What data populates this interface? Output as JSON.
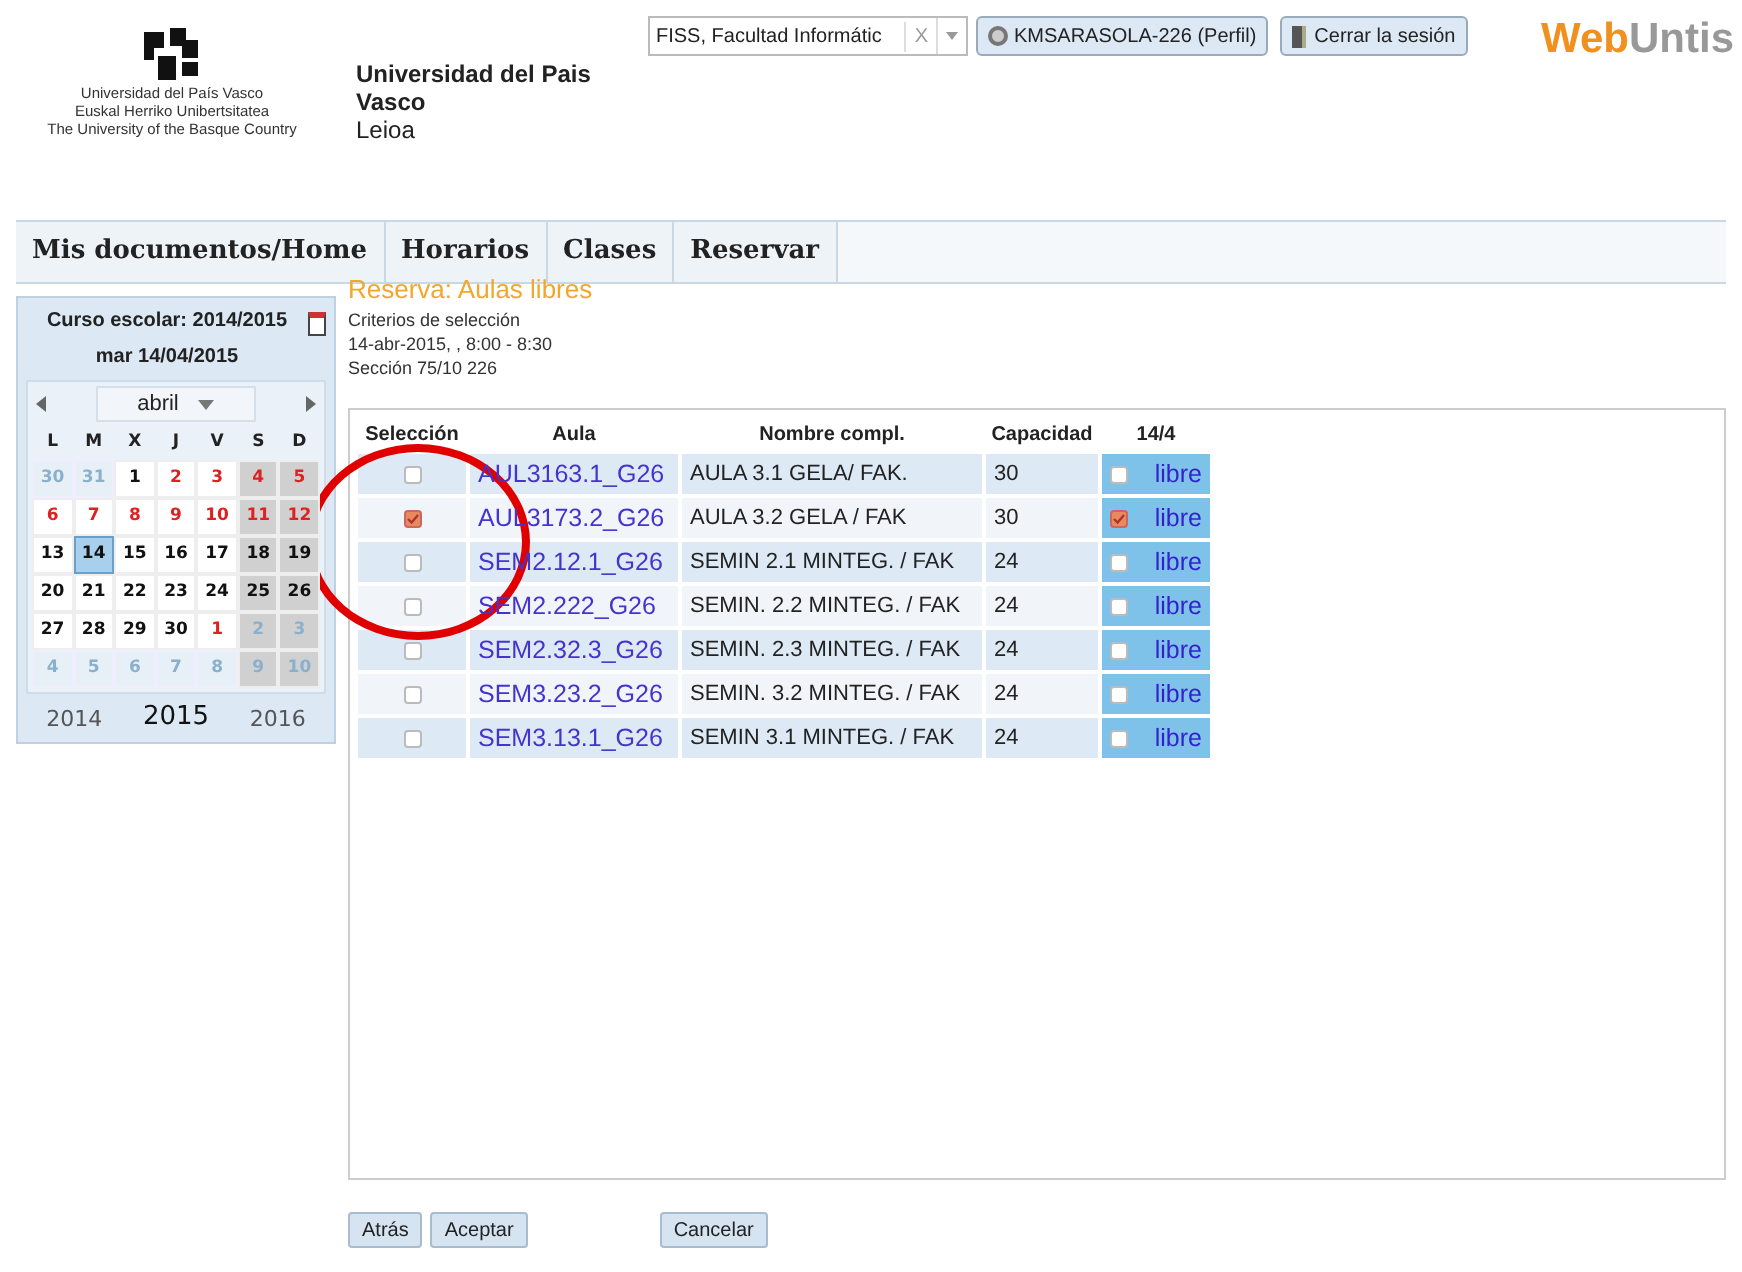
{
  "header": {
    "logo_lines": [
      "Universidad del País Vasco",
      "Euskal Herriko Unibertsitatea",
      "The University of the Basque Country"
    ],
    "university": "Universidad del Pais Vasco",
    "campus": "Leioa",
    "school_select": {
      "value": "FISS, Facultad Informátic",
      "clear": "X"
    },
    "profile_button": "KMSARASOLA-226 (Perfil)",
    "logout_button": "Cerrar la sesión",
    "brand": {
      "part1": "Web",
      "part2": "Untis"
    }
  },
  "nav": [
    {
      "label": "Mis documentos/Home",
      "selected": false
    },
    {
      "label": "Horarios",
      "selected": false
    },
    {
      "label": "Clases",
      "selected": false
    },
    {
      "label": "Reservar",
      "selected": false
    }
  ],
  "sidebar": {
    "school_year": "Curso escolar: 2014/2015",
    "date": "mar 14/04/2015",
    "month": "abril",
    "weekdays": [
      "L",
      "M",
      "X",
      "J",
      "V",
      "S",
      "D"
    ],
    "weeks": [
      [
        {
          "day": "30",
          "kind": "other",
          "weekend": false,
          "selected": false
        },
        {
          "day": "31",
          "kind": "other",
          "weekend": false,
          "selected": false
        },
        {
          "day": "1",
          "kind": "normal",
          "weekend": false,
          "selected": false
        },
        {
          "day": "2",
          "kind": "holiday",
          "weekend": false,
          "selected": false
        },
        {
          "day": "3",
          "kind": "holiday",
          "weekend": false,
          "selected": false
        },
        {
          "day": "4",
          "kind": "holiday",
          "weekend": true,
          "selected": false
        },
        {
          "day": "5",
          "kind": "holiday",
          "weekend": true,
          "selected": false
        }
      ],
      [
        {
          "day": "6",
          "kind": "holiday",
          "weekend": false,
          "selected": false
        },
        {
          "day": "7",
          "kind": "holiday",
          "weekend": false,
          "selected": false
        },
        {
          "day": "8",
          "kind": "holiday",
          "weekend": false,
          "selected": false
        },
        {
          "day": "9",
          "kind": "holiday",
          "weekend": false,
          "selected": false
        },
        {
          "day": "10",
          "kind": "holiday",
          "weekend": false,
          "selected": false
        },
        {
          "day": "11",
          "kind": "holiday",
          "weekend": true,
          "selected": false
        },
        {
          "day": "12",
          "kind": "holiday",
          "weekend": true,
          "selected": false
        }
      ],
      [
        {
          "day": "13",
          "kind": "normal",
          "weekend": false,
          "selected": false
        },
        {
          "day": "14",
          "kind": "normal",
          "weekend": false,
          "selected": true
        },
        {
          "day": "15",
          "kind": "normal",
          "weekend": false,
          "selected": false
        },
        {
          "day": "16",
          "kind": "normal",
          "weekend": false,
          "selected": false
        },
        {
          "day": "17",
          "kind": "normal",
          "weekend": false,
          "selected": false
        },
        {
          "day": "18",
          "kind": "normal",
          "weekend": true,
          "selected": false
        },
        {
          "day": "19",
          "kind": "normal",
          "weekend": true,
          "selected": false
        }
      ],
      [
        {
          "day": "20",
          "kind": "normal",
          "weekend": false,
          "selected": false
        },
        {
          "day": "21",
          "kind": "normal",
          "weekend": false,
          "selected": false
        },
        {
          "day": "22",
          "kind": "normal",
          "weekend": false,
          "selected": false
        },
        {
          "day": "23",
          "kind": "normal",
          "weekend": false,
          "selected": false
        },
        {
          "day": "24",
          "kind": "normal",
          "weekend": false,
          "selected": false
        },
        {
          "day": "25",
          "kind": "normal",
          "weekend": true,
          "selected": false
        },
        {
          "day": "26",
          "kind": "normal",
          "weekend": true,
          "selected": false
        }
      ],
      [
        {
          "day": "27",
          "kind": "normal",
          "weekend": false,
          "selected": false
        },
        {
          "day": "28",
          "kind": "normal",
          "weekend": false,
          "selected": false
        },
        {
          "day": "29",
          "kind": "normal",
          "weekend": false,
          "selected": false
        },
        {
          "day": "30",
          "kind": "normal",
          "weekend": false,
          "selected": false
        },
        {
          "day": "1",
          "kind": "holiday",
          "weekend": false,
          "selected": false
        },
        {
          "day": "2",
          "kind": "other",
          "weekend": true,
          "selected": false
        },
        {
          "day": "3",
          "kind": "other",
          "weekend": true,
          "selected": false
        }
      ],
      [
        {
          "day": "4",
          "kind": "other",
          "weekend": false,
          "selected": false
        },
        {
          "day": "5",
          "kind": "other",
          "weekend": false,
          "selected": false
        },
        {
          "day": "6",
          "kind": "other",
          "weekend": false,
          "selected": false
        },
        {
          "day": "7",
          "kind": "other",
          "weekend": false,
          "selected": false
        },
        {
          "day": "8",
          "kind": "other",
          "weekend": false,
          "selected": false
        },
        {
          "day": "9",
          "kind": "other",
          "weekend": true,
          "selected": false
        },
        {
          "day": "10",
          "kind": "other",
          "weekend": true,
          "selected": false
        }
      ]
    ],
    "years": [
      {
        "label": "2014",
        "selected": false
      },
      {
        "label": "2015",
        "selected": true
      },
      {
        "label": "2016",
        "selected": false
      }
    ]
  },
  "content": {
    "title": "Reserva: Aulas libres",
    "criteria": [
      "Criterios de selección",
      "14-abr-2015, , 8:00 - 8:30",
      "Sección 75/10 226"
    ],
    "table": {
      "columns": [
        "Selección",
        "Aula",
        "Nombre compl.",
        "Capacidad",
        "14/4"
      ],
      "rows": [
        {
          "checked": false,
          "aula": "AUL3163.1_G26",
          "name": "AULA 3.1 GELA/ FAK.",
          "capacity": "30",
          "slot_checked": false,
          "slot": "libre"
        },
        {
          "checked": true,
          "aula": "AUL3173.2_G26",
          "name": "AULA 3.2 GELA / FAK",
          "capacity": "30",
          "slot_checked": true,
          "slot": "libre"
        },
        {
          "checked": false,
          "aula": "SEM2.12.1_G26",
          "name": "SEMIN 2.1 MINTEG. / FAK",
          "capacity": "24",
          "slot_checked": false,
          "slot": "libre"
        },
        {
          "checked": false,
          "aula": "SEM2.222_G26",
          "name": "SEMIN. 2.2 MINTEG. / FAK",
          "capacity": "24",
          "slot_checked": false,
          "slot": "libre"
        },
        {
          "checked": false,
          "aula": "SEM2.32.3_G26",
          "name": "SEMIN. 2.3 MINTEG. / FAK",
          "capacity": "24",
          "slot_checked": false,
          "slot": "libre"
        },
        {
          "checked": false,
          "aula": "SEM3.23.2_G26",
          "name": "SEMIN. 3.2 MINTEG. / FAK",
          "capacity": "24",
          "slot_checked": false,
          "slot": "libre"
        },
        {
          "checked": false,
          "aula": "SEM3.13.1_G26",
          "name": "SEMIN 3.1 MINTEG. / FAK",
          "capacity": "24",
          "slot_checked": false,
          "slot": "libre"
        }
      ]
    },
    "buttons": [
      "Atrás",
      "Aceptar",
      "Cancelar"
    ]
  }
}
